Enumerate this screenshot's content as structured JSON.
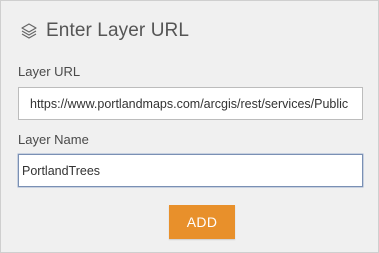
{
  "panel": {
    "title": "Enter Layer URL",
    "header_icon": "layers-icon"
  },
  "form": {
    "url_label": "Layer URL",
    "url_value": "https://www.portlandmaps.com/arcgis/rest/services/Public",
    "name_label": "Layer Name",
    "name_value": "PortlandTrees",
    "add_label": "ADD"
  },
  "colors": {
    "panel_background": "#f0f0f0",
    "add_button": "#e8902b",
    "focused_border": "#7a90b4"
  }
}
